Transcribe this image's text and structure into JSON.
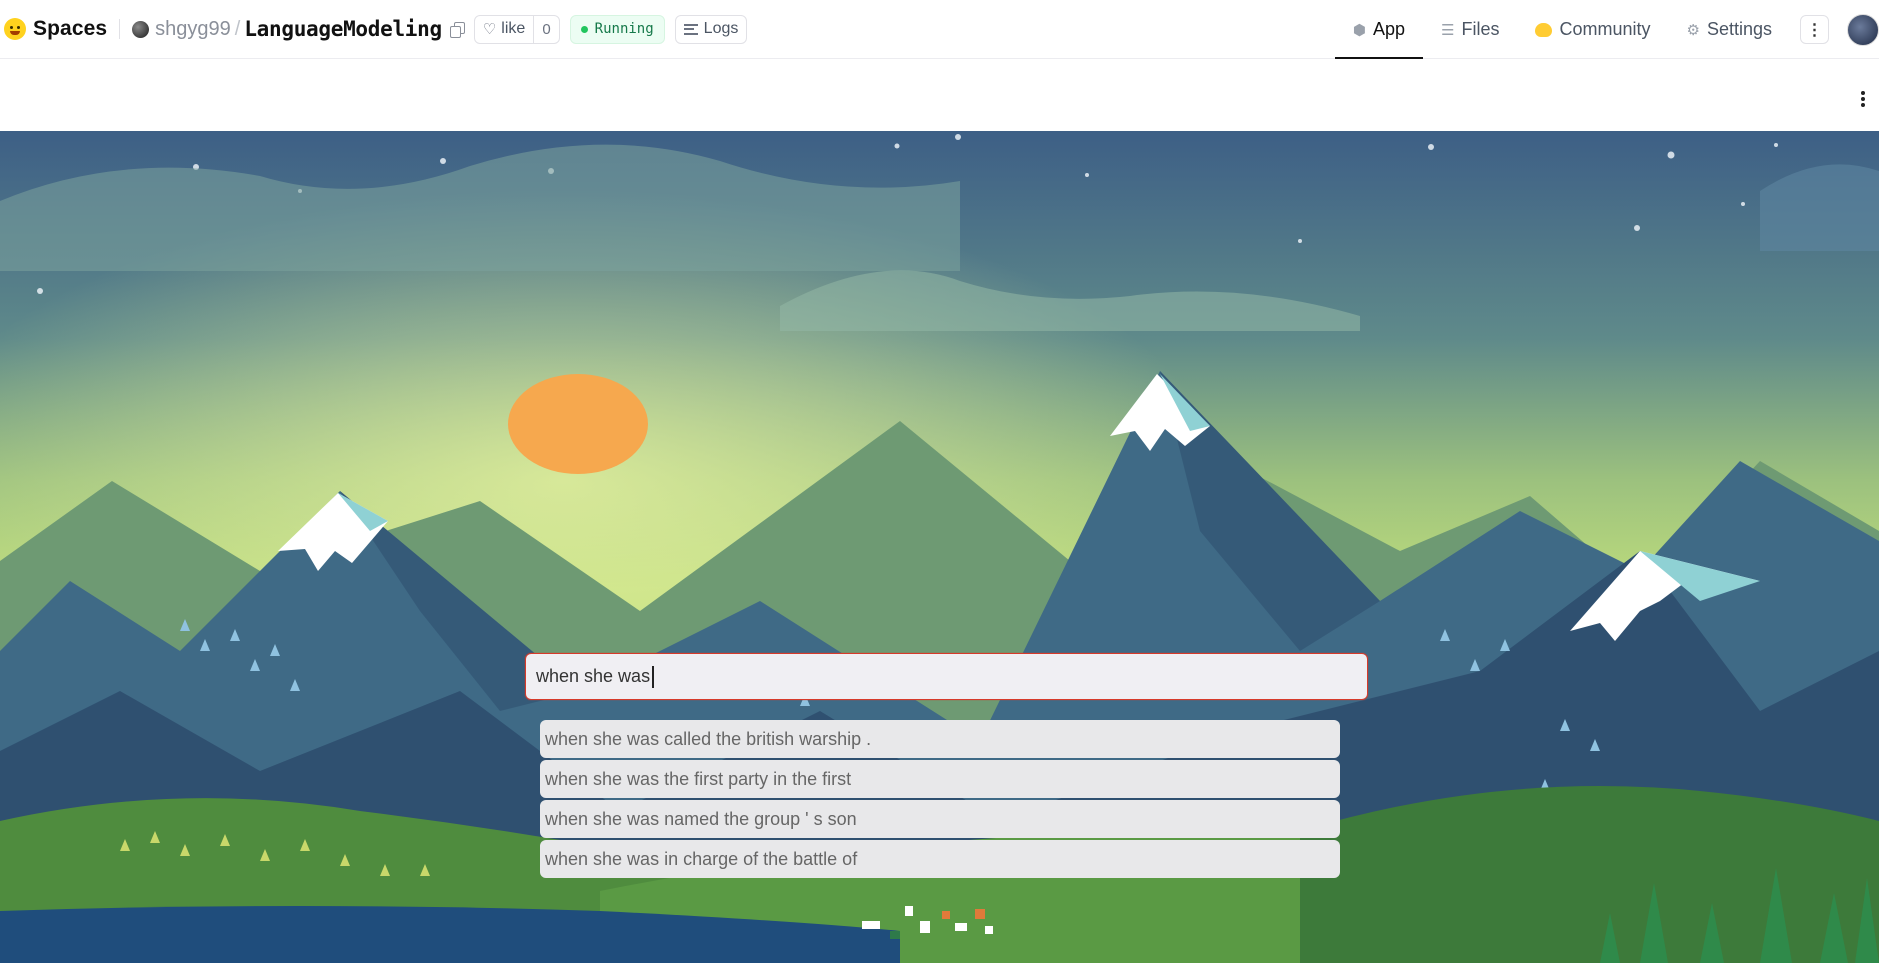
{
  "header": {
    "brand": "Spaces",
    "owner": "shgyg99",
    "separator": "/",
    "repo": "LanguageModeling",
    "like_label": "like",
    "like_count": "0",
    "status": "Running",
    "logs_label": "Logs",
    "tabs": [
      {
        "label": "App",
        "icon": "cube-icon",
        "active": true
      },
      {
        "label": "Files",
        "icon": "files-icon",
        "active": false
      },
      {
        "label": "Community",
        "icon": "community-icon",
        "active": false
      },
      {
        "label": "Settings",
        "icon": "gear-icon",
        "active": false
      }
    ]
  },
  "app": {
    "input_value": "when she was",
    "suggestions": [
      "when she was called the british warship .",
      "when she was the first party in the first",
      "when she was named the group ' s son",
      "when she was in charge of the battle of"
    ]
  },
  "colors": {
    "status_green": "#22c55e",
    "input_border": "#d73a2a",
    "sky_top": "#3f6286",
    "sky_glow": "#b9d97c",
    "sun": "#f6a84e",
    "mountain_dark": "#2d4a6b",
    "grass": "#4f9044",
    "lake": "#1f4d7c"
  }
}
